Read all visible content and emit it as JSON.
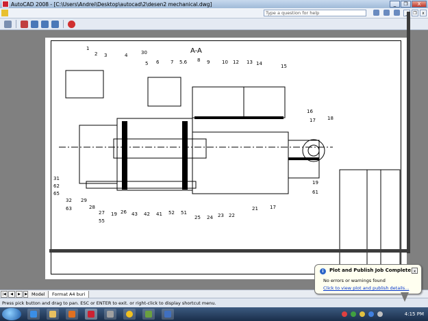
{
  "window": {
    "title": "AutoCAD 2008 - [C:\\Users\\Andrei\\Desktop\\autocad\\2\\desen2 mechanical.dwg]",
    "buttons": {
      "minimize": "_",
      "restore": "❐",
      "close": "X"
    }
  },
  "menubar": {
    "help_placeholder": "Type a question for help",
    "doc_buttons": {
      "minimize": "_",
      "restore": "❐",
      "close": "x"
    }
  },
  "toolbar": {
    "icons": [
      "plot-icon",
      "pan-icon",
      "zoom-realtime-icon",
      "zoom-window-icon",
      "zoom-previous-icon",
      "close-preview-icon"
    ]
  },
  "drawing": {
    "section_label": "A-A",
    "callouts_top": [
      "1",
      "2",
      "3",
      "4",
      "30",
      "5",
      "6",
      "7",
      "5.6",
      "8",
      "9",
      "10",
      "12",
      "13",
      "14",
      "15"
    ],
    "callouts_right": [
      "16",
      "17",
      "18",
      "19",
      "61"
    ],
    "callouts_left": [
      "31",
      "62",
      "65",
      "32",
      "63"
    ],
    "callouts_bottom": [
      "29",
      "28",
      "27",
      "55",
      "19",
      "26",
      "43",
      "42",
      "41",
      "52",
      "51",
      "25",
      "24",
      "23",
      "22",
      "21",
      "17"
    ]
  },
  "tabs": {
    "nav": [
      "|◀",
      "◀",
      "▶",
      "▶|"
    ],
    "items": [
      {
        "label": "Model",
        "active": true
      },
      {
        "label": "Format A4 buri",
        "active": false
      }
    ]
  },
  "status": {
    "text": "Press pick button and drag to pan. ESC or ENTER to exit. or right-click to display shortcut menu."
  },
  "balloon": {
    "icon": "i",
    "title": "Plot and Publish Job Complete",
    "message": "No errors or warnings found",
    "link": "Click to view plot and publish details...",
    "close": "x"
  },
  "taskbar": {
    "clock": "4:15 PM"
  },
  "colors": {
    "canvas_bg": "#808080",
    "paper": "#ffffff",
    "taskbar": "#1a2e4a",
    "balloon_bg": "#fffff0",
    "link": "#0033cc"
  }
}
